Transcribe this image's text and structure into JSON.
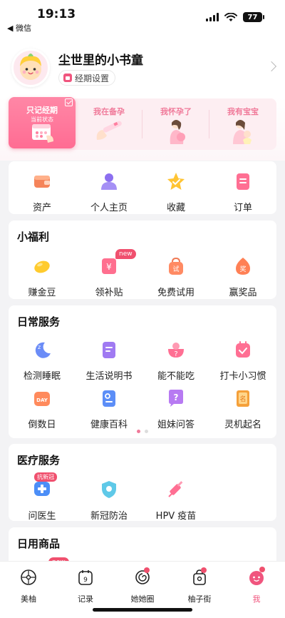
{
  "status_bar": {
    "time": "19:13",
    "back_label": "◀ 微信",
    "battery": "77"
  },
  "profile": {
    "username": "尘世里的小书童",
    "period_settings": "经期设置"
  },
  "status_cards": [
    {
      "label": "只记经期",
      "sub": "当前状态",
      "active": true
    },
    {
      "label": "我在备孕",
      "sub": "",
      "active": false
    },
    {
      "label": "我怀孕了",
      "sub": "",
      "active": false
    },
    {
      "label": "我有宝宝",
      "sub": "",
      "active": false
    }
  ],
  "quick": [
    {
      "label": "资产",
      "icon": "wallet-icon"
    },
    {
      "label": "个人主页",
      "icon": "person-icon"
    },
    {
      "label": "收藏",
      "icon": "star-icon"
    },
    {
      "label": "订单",
      "icon": "order-icon"
    }
  ],
  "welfare": {
    "title": "小福利",
    "items": [
      {
        "label": "赚金豆",
        "icon": "bean-icon"
      },
      {
        "label": "领补贴",
        "icon": "subsidy-icon",
        "badge": "new"
      },
      {
        "label": "免费试用",
        "icon": "trial-icon"
      },
      {
        "label": "赢奖品",
        "icon": "prize-icon"
      }
    ]
  },
  "daily": {
    "title": "日常服务",
    "row1": [
      {
        "label": "检测睡眠",
        "icon": "sleep-icon"
      },
      {
        "label": "生活说明书",
        "icon": "manual-icon"
      },
      {
        "label": "能不能吃",
        "icon": "food-question-icon"
      },
      {
        "label": "打卡小习惯",
        "icon": "checkin-icon"
      }
    ],
    "row2": [
      {
        "label": "倒数日",
        "icon": "countdown-icon"
      },
      {
        "label": "健康百科",
        "icon": "encyclopedia-icon"
      },
      {
        "label": "姐妹问答",
        "icon": "qa-icon"
      },
      {
        "label": "灵机起名",
        "icon": "naming-icon"
      }
    ]
  },
  "medical": {
    "title": "医疗服务",
    "items": [
      {
        "label": "问医生",
        "icon": "doctor-icon",
        "badge": "抗新冠"
      },
      {
        "label": "新冠防治",
        "icon": "shield-icon"
      },
      {
        "label": "HPV 疫苗",
        "icon": "vaccine-icon"
      }
    ]
  },
  "goods": {
    "title": "日用商品",
    "badge": "new"
  },
  "tabs": [
    {
      "label": "美柚",
      "icon": "meiyou-icon"
    },
    {
      "label": "记录",
      "icon": "calendar-icon",
      "num": "9"
    },
    {
      "label": "她她圈",
      "icon": "circle-icon"
    },
    {
      "label": "柚子街",
      "icon": "bag-icon"
    },
    {
      "label": "我",
      "icon": "me-icon"
    }
  ],
  "colors": {
    "accent": "#f0557e",
    "background": "#f3f3f5"
  }
}
